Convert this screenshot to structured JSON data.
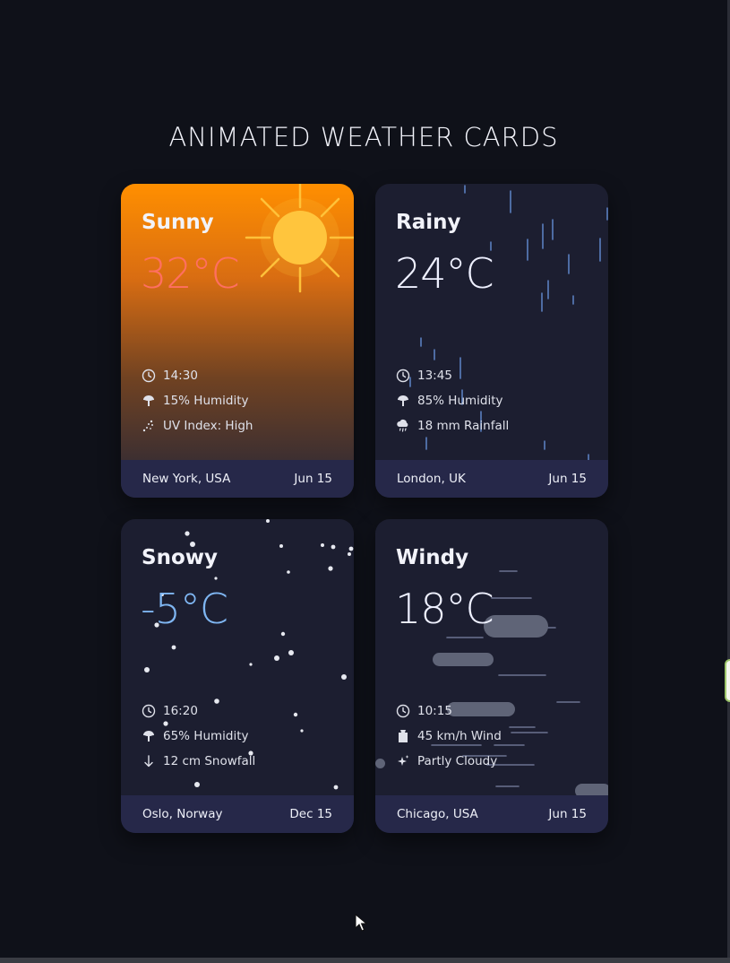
{
  "page": {
    "title": "ANIMATED WEATHER CARDS"
  },
  "colors": {
    "background": "#0f1119",
    "card_background": "#1c1e30",
    "footer_background": "#262849",
    "sunny_temp": "#ff6f61",
    "rainy_temp": "#eef0ff",
    "snowy_temp": "#7fb6f2",
    "windy_temp": "#eef0ff",
    "sun": "#ffc53d",
    "rain": "#5a7fc0",
    "snow": "#e7e9f0",
    "cloud": "#5f6477"
  },
  "cards": [
    {
      "condition": "Sunny",
      "temperature": "32°C",
      "details": [
        {
          "icon": "clock-icon",
          "text": "14:30"
        },
        {
          "icon": "humidity-icon",
          "text": "15% Humidity"
        },
        {
          "icon": "uv-icon",
          "text": "UV Index: High"
        }
      ],
      "location": "New York, USA",
      "date": "Jun 15"
    },
    {
      "condition": "Rainy",
      "temperature": "24°C",
      "details": [
        {
          "icon": "clock-icon",
          "text": "13:45"
        },
        {
          "icon": "humidity-icon",
          "text": "85% Humidity"
        },
        {
          "icon": "rain-cloud-icon",
          "text": "18 mm Rainfall"
        }
      ],
      "location": "London, UK",
      "date": "Jun 15"
    },
    {
      "condition": "Snowy",
      "temperature": "-5°C",
      "details": [
        {
          "icon": "clock-icon",
          "text": "16:20"
        },
        {
          "icon": "humidity-icon",
          "text": "65% Humidity"
        },
        {
          "icon": "arrow-down-icon",
          "text": "12 cm Snowfall"
        }
      ],
      "location": "Oslo, Norway",
      "date": "Dec 15"
    },
    {
      "condition": "Windy",
      "temperature": "18°C",
      "details": [
        {
          "icon": "clock-icon",
          "text": "10:15"
        },
        {
          "icon": "wind-icon",
          "text": "45 km/h Wind"
        },
        {
          "icon": "sparkle-icon",
          "text": "Partly Cloudy"
        }
      ],
      "location": "Chicago, USA",
      "date": "Jun 15"
    }
  ]
}
